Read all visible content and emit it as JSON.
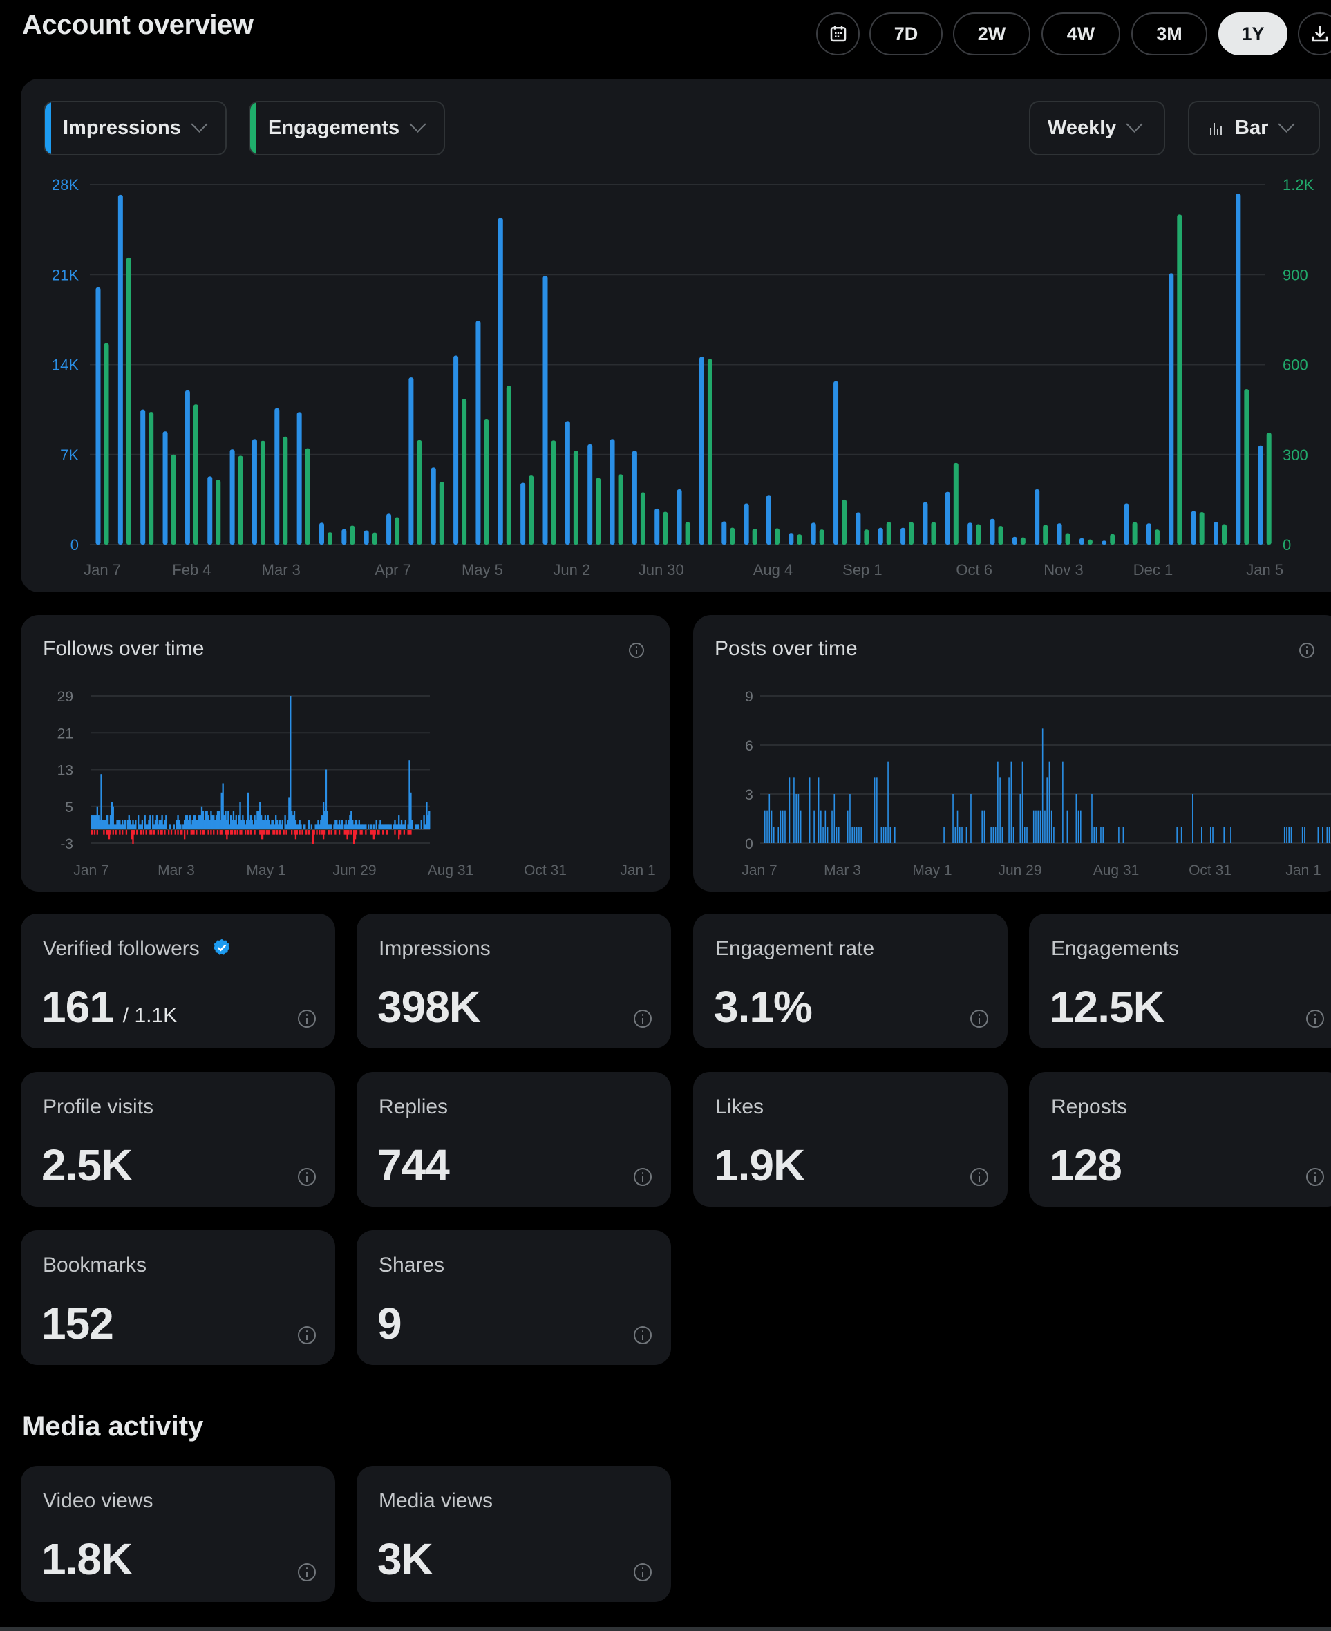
{
  "header": {
    "title": "Account overview",
    "range_buttons": [
      {
        "label": "7D",
        "selected": false
      },
      {
        "label": "2W",
        "selected": false
      },
      {
        "label": "4W",
        "selected": false
      },
      {
        "label": "3M",
        "selected": false
      },
      {
        "label": "1Y",
        "selected": true
      }
    ],
    "calendar_icon": "calendar-icon",
    "download_icon": "download-icon"
  },
  "main_chart_controls": {
    "metric_1": {
      "label": "Impressions",
      "color": "#1d9bf0"
    },
    "metric_2": {
      "label": "Engagements",
      "color": "#1fae6b"
    },
    "interval": "Weekly",
    "chart_type": "Bar",
    "chart_type_icon": "bar-chart-icon"
  },
  "colors": {
    "impressions": "#2a8fe6",
    "engagements": "#21a96b",
    "follows_gained": "#2a8fe6",
    "follows_lost": "#f4212e",
    "posts": "#2a8fe6",
    "background": "#000000",
    "card": "#16181c"
  },
  "chart_data": [
    {
      "id": "impressions_engagements",
      "type": "bar",
      "title": "",
      "interval": "Weekly",
      "x_tick_labels": [
        "Jan 7",
        "Feb 4",
        "Mar 3",
        "Apr 7",
        "May 5",
        "Jun 2",
        "Jun 30",
        "Aug 4",
        "Sep 1",
        "Oct 6",
        "Nov 3",
        "Dec 1",
        "Jan 5"
      ],
      "x_tick_index": [
        0,
        4,
        8,
        13,
        17,
        21,
        25,
        30,
        34,
        39,
        43,
        47,
        52
      ],
      "left_axis": {
        "label": "Impressions",
        "ticks": [
          "0",
          "7K",
          "14K",
          "21K",
          "28K"
        ],
        "range": [
          0,
          28000
        ]
      },
      "right_axis": {
        "label": "Engagements",
        "ticks": [
          "0",
          "300",
          "600",
          "900",
          "1.2K"
        ],
        "range": [
          0,
          1200
        ]
      },
      "grid": true,
      "series": [
        {
          "name": "Impressions",
          "axis": "left",
          "values": [
            20000,
            27200,
            10500,
            8800,
            12000,
            5300,
            7400,
            8200,
            10600,
            10300,
            1700,
            1200,
            1100,
            2400,
            13000,
            6000,
            14700,
            17400,
            25400,
            4800,
            20900,
            9600,
            7800,
            8200,
            7300,
            2800,
            4300,
            14600,
            1800,
            3200,
            3850,
            900,
            1700,
            12700,
            2500,
            1300,
            1300,
            3300,
            4100,
            1700,
            2000,
            600,
            4300,
            1650,
            500,
            300,
            3200,
            1650,
            21100,
            2600,
            1750,
            27300,
            7700
          ]
        },
        {
          "name": "Engagements",
          "axis": "right",
          "values": [
            671,
            956,
            442,
            300,
            467,
            216,
            296,
            346,
            360,
            321,
            41,
            63,
            40,
            91,
            348,
            209,
            485,
            417,
            529,
            230,
            347,
            313,
            222,
            234,
            174,
            109,
            75,
            618,
            56,
            53,
            54,
            34,
            50,
            150,
            50,
            75,
            75,
            75,
            272,
            68,
            62,
            24,
            66,
            38,
            17,
            35,
            75,
            50,
            1100,
            108,
            68,
            518,
            373
          ]
        }
      ]
    },
    {
      "id": "follows_over_time",
      "type": "bar",
      "title": "Follows over time",
      "x_tick_labels": [
        "Jan 7",
        "Mar 3",
        "May 1",
        "Jun 29",
        "Aug 31",
        "Oct 31",
        "Jan 1"
      ],
      "y_ticks": [
        "-3",
        "5",
        "13",
        "21",
        "29"
      ],
      "ylim": [
        -3,
        29
      ],
      "grid": true,
      "series": [
        {
          "name": "Gained",
          "values": [
            3,
            3,
            3,
            3,
            5,
            3,
            2,
            12,
            2,
            2,
            2,
            3,
            3,
            1,
            3,
            6,
            5,
            1,
            1,
            2,
            2,
            2,
            1,
            2,
            1,
            2,
            0,
            2,
            3,
            2,
            1,
            2,
            1,
            2,
            0,
            3,
            1,
            1,
            2,
            0,
            3,
            1,
            1,
            2,
            3,
            0,
            3,
            1,
            2,
            3,
            1,
            2,
            2,
            3,
            1,
            2,
            3,
            0,
            0,
            1,
            0,
            0,
            1,
            0,
            2,
            3,
            2,
            1,
            0,
            1,
            2,
            3,
            3,
            2,
            3,
            1,
            2,
            3,
            3,
            2,
            2,
            3,
            3,
            5,
            4,
            2,
            4,
            4,
            3,
            2,
            4,
            3,
            3,
            2,
            3,
            4,
            4,
            2,
            8,
            10,
            3,
            4,
            2,
            4,
            1,
            3,
            2,
            4,
            2,
            3,
            1,
            3,
            6,
            2,
            3,
            2,
            1,
            2,
            8,
            2,
            3,
            2,
            1,
            3,
            2,
            4,
            4,
            6,
            3,
            2,
            2,
            3,
            2,
            3,
            2,
            1,
            2,
            2,
            1,
            3,
            2,
            1,
            2,
            1,
            2,
            0,
            3,
            1,
            2,
            7,
            29,
            4,
            3,
            4,
            2,
            1,
            1,
            2,
            1,
            0,
            1,
            1,
            0,
            0,
            2,
            0,
            1,
            0,
            0,
            1,
            1,
            2,
            1,
            2,
            3,
            6,
            4,
            13,
            4,
            1,
            1,
            1,
            0,
            1,
            2,
            2,
            1,
            2,
            1,
            2,
            0,
            1,
            2,
            1,
            2,
            3,
            4,
            2,
            1,
            2,
            2,
            1,
            2,
            1,
            1,
            1,
            1,
            1,
            0,
            1,
            0,
            1,
            0,
            1,
            0,
            2,
            0,
            1,
            2,
            1,
            1,
            1,
            1,
            1,
            1,
            1,
            1,
            0,
            1,
            2,
            1,
            1,
            3,
            1,
            2,
            1,
            1,
            2,
            0,
            1,
            15,
            8,
            2,
            0,
            0,
            1,
            1,
            1,
            0,
            2,
            0,
            3,
            1,
            6,
            3,
            4
          ]
        },
        {
          "name": "Lost",
          "values": [
            -1,
            0,
            -1,
            0,
            -1,
            0,
            0,
            0,
            0,
            -1,
            0,
            -1,
            -1,
            -2,
            -1,
            0,
            -1,
            0,
            -1,
            0,
            0,
            -1,
            0,
            -1,
            0,
            0,
            -1,
            0,
            0,
            0,
            -2,
            -3,
            -1,
            0,
            -1,
            0,
            0,
            -1,
            0,
            -1,
            0,
            -1,
            0,
            0,
            -1,
            -1,
            0,
            -1,
            0,
            0,
            -1,
            0,
            -1,
            -1,
            0,
            -1,
            0,
            0,
            -1,
            0,
            -1,
            0,
            0,
            -1,
            0,
            -1,
            0,
            -1,
            -1,
            0,
            -2,
            0,
            -1,
            0,
            0,
            -1,
            -1,
            -1,
            0,
            -1,
            0,
            0,
            -1,
            0,
            -1,
            -1,
            0,
            0,
            -1,
            0,
            -1,
            0,
            -1,
            0,
            0,
            -1,
            0,
            -1,
            -1,
            0,
            0,
            -1,
            -2,
            -1,
            0,
            -1,
            -1,
            0,
            -1,
            0,
            -1,
            0,
            -1,
            -1,
            0,
            0,
            -1,
            0,
            -1,
            0,
            -1,
            0,
            0,
            -1,
            0,
            0,
            0,
            -1,
            -2,
            -2,
            -1,
            0,
            -1,
            -1,
            -1,
            0,
            0,
            -1,
            -1,
            0,
            -1,
            0,
            -1,
            0,
            0,
            -1,
            0,
            -1,
            0,
            0,
            0,
            -1,
            0,
            -1,
            -2,
            -1,
            0,
            -1,
            0,
            -1,
            0,
            0,
            -1,
            0,
            -1,
            0,
            0,
            -3,
            -1,
            0,
            -1,
            0,
            -1,
            0,
            -1,
            -2,
            -1,
            0,
            0,
            -1,
            0,
            -1,
            0,
            0,
            -1,
            0,
            0,
            -1,
            0,
            0,
            0,
            -1,
            -1,
            -2,
            -1,
            0,
            -1,
            0,
            -3,
            -2,
            -1,
            0,
            0,
            -1,
            -1,
            0,
            0,
            -1,
            0,
            0,
            0,
            -1,
            -1,
            -2,
            -1,
            0,
            -1,
            -1,
            0,
            0,
            -1,
            0,
            0,
            -1,
            0,
            0,
            0,
            0,
            0,
            -1,
            0,
            0,
            -2,
            -1,
            0,
            0,
            -1,
            0,
            0,
            -1,
            -1,
            -1
          ]
        }
      ]
    },
    {
      "id": "posts_over_time",
      "type": "bar",
      "title": "Posts over time",
      "x_tick_labels": [
        "Jan 7",
        "Mar 3",
        "May 1",
        "Jun 29",
        "Aug 31",
        "Oct 31",
        "Jan 1"
      ],
      "y_ticks": [
        "0",
        "3",
        "6",
        "9"
      ],
      "ylim": [
        0,
        9
      ],
      "grid": true,
      "series": [
        {
          "name": "Posts",
          "values": [
            2,
            2,
            3,
            2,
            1,
            0,
            1,
            2,
            2,
            2,
            0,
            4,
            0,
            4,
            3,
            3,
            2,
            0,
            0,
            0,
            4,
            0,
            2,
            0,
            4,
            2,
            1,
            2,
            1,
            0,
            2,
            3,
            1,
            1,
            0,
            0,
            0,
            2,
            3,
            1,
            1,
            1,
            1,
            1,
            0,
            0,
            0,
            0,
            0,
            4,
            4,
            0,
            1,
            1,
            1,
            5,
            1,
            0,
            1,
            0,
            0,
            0,
            0,
            0,
            0,
            0,
            0,
            0,
            0,
            0,
            0,
            0,
            0,
            0,
            0,
            0,
            0,
            0,
            0,
            0,
            1,
            0,
            0,
            0,
            3,
            1,
            2,
            1,
            1,
            0,
            1,
            0,
            3,
            0,
            0,
            0,
            0,
            2,
            2,
            0,
            0,
            1,
            1,
            1,
            5,
            4,
            1,
            0,
            0,
            4,
            5,
            1,
            0,
            0,
            3,
            5,
            1,
            1,
            0,
            0,
            2,
            2,
            2,
            2,
            7,
            2,
            4,
            5,
            2,
            1,
            0,
            0,
            0,
            5,
            0,
            2,
            0,
            0,
            0,
            3,
            2,
            2,
            0,
            0,
            0,
            0,
            3,
            1,
            1,
            0,
            1,
            1,
            0,
            0,
            0,
            0,
            0,
            0,
            1,
            0,
            1,
            0,
            0,
            0,
            0,
            0,
            0,
            0,
            0,
            0,
            0,
            0,
            0,
            0,
            0,
            0,
            0,
            0,
            0,
            0,
            0,
            0,
            0,
            0,
            1,
            0,
            1,
            0,
            0,
            0,
            0,
            3,
            0,
            0,
            0,
            1,
            0,
            0,
            0,
            1,
            1,
            0,
            0,
            0,
            0,
            1,
            0,
            0,
            1,
            0,
            0,
            0,
            0,
            0,
            0,
            0,
            0,
            0,
            0,
            0,
            0,
            0,
            0,
            0,
            0,
            0,
            0,
            0,
            0,
            0,
            0,
            0,
            1,
            1,
            1,
            1,
            0,
            0,
            0,
            0,
            1,
            1,
            0,
            0,
            0,
            0,
            0,
            1,
            0,
            1,
            0,
            1,
            1
          ]
        }
      ]
    }
  ],
  "follows_card": {
    "title": "Follows over time",
    "info_icon": "info-icon"
  },
  "posts_card": {
    "title": "Posts over time",
    "info_icon": "info-icon"
  },
  "stats": [
    {
      "label": "Verified followers",
      "value": "161",
      "sub": "/ 1.1K",
      "badge": "verified-badge-icon"
    },
    {
      "label": "Impressions",
      "value": "398K"
    },
    {
      "label": "Engagement rate",
      "value": "3.1%"
    },
    {
      "label": "Engagements",
      "value": "12.5K"
    },
    {
      "label": "Profile visits",
      "value": "2.5K"
    },
    {
      "label": "Replies",
      "value": "744"
    },
    {
      "label": "Likes",
      "value": "1.9K"
    },
    {
      "label": "Reposts",
      "value": "128"
    },
    {
      "label": "Bookmarks",
      "value": "152"
    },
    {
      "label": "Shares",
      "value": "9"
    }
  ],
  "media_activity": {
    "title": "Media activity",
    "stats": [
      {
        "label": "Video views",
        "value": "1.8K"
      },
      {
        "label": "Media views",
        "value": "3K"
      }
    ]
  }
}
